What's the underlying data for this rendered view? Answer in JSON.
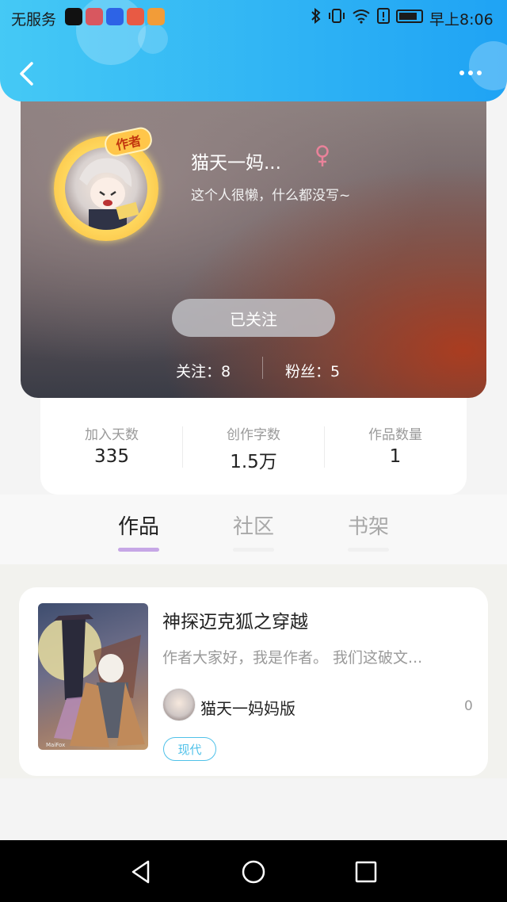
{
  "status_bar": {
    "carrier": "无服务",
    "time": "早上8:06",
    "app_icons": [
      "tiktok-icon",
      "app-icon",
      "baidu-icon",
      "bilibili-icon",
      "video-icon"
    ],
    "system_icons": [
      "bluetooth-icon",
      "vibrate-icon",
      "wifi-icon",
      "alert-icon",
      "battery-icon"
    ]
  },
  "header": {
    "back_icon": "chevron-left-icon",
    "more_icon": "more-dots-icon",
    "accent_color": "#1fa3f4"
  },
  "profile": {
    "badge": "作者",
    "nickname": "猫天一妈...",
    "gender_icon": "female-icon",
    "gender_color": "#e9829a",
    "signature": "这个人很懒，什么都没写~",
    "follow_button": "已关注",
    "following": "关注：8",
    "fans": "粉丝：5"
  },
  "stats": [
    {
      "label": "加入天数",
      "value": "335"
    },
    {
      "label": "创作字数",
      "value": "1.5万"
    },
    {
      "label": "作品数量",
      "value": "1"
    }
  ],
  "tabs": [
    {
      "label": "作品",
      "active": true
    },
    {
      "label": "社区",
      "active": false
    },
    {
      "label": "书架",
      "active": false
    }
  ],
  "works": [
    {
      "title": "神探迈克狐之穿越",
      "description": "作者大家好，我是作者。    我们这破文...",
      "author": "猫天一妈妈版",
      "count": "0",
      "tag": "现代",
      "cover_text": "MaiFox"
    }
  ],
  "nav_bar": {
    "icons": [
      "back-triangle-icon",
      "home-circle-icon",
      "recents-square-icon"
    ]
  }
}
